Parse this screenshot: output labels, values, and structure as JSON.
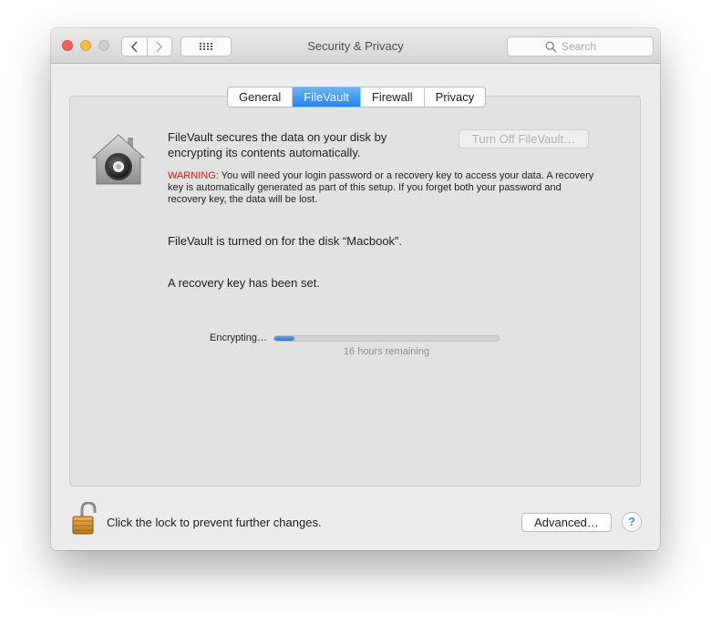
{
  "window": {
    "title": "Security & Privacy"
  },
  "toolbar": {
    "back_icon": "chevron-left-icon",
    "forward_icon": "chevron-right-icon",
    "show_all_icon": "grid-icon",
    "search": {
      "placeholder": "Search",
      "icon": "search-icon"
    }
  },
  "tabs": [
    {
      "label": "General",
      "active": false
    },
    {
      "label": "FileVault",
      "active": true
    },
    {
      "label": "Firewall",
      "active": false
    },
    {
      "label": "Privacy",
      "active": false
    }
  ],
  "filevault": {
    "icon": "filevault-house-safe-icon",
    "intro": "FileVault secures the data on your disk by encrypting its contents automatically.",
    "turn_off_label": "Turn Off FileVault…",
    "warning_label": "WARNING:",
    "warning_text": " You will need your login password or a recovery key to access your data. A recovery key is automatically generated as part of this setup. If you forget both your password and recovery key, the data will be lost.",
    "status_on": "FileVault is turned on for the disk “Macbook”.",
    "status_key": "A recovery key has been set.",
    "encrypting_label": "Encrypting…",
    "progress_percent": 9,
    "remaining": "16 hours remaining"
  },
  "footer": {
    "lock_icon": "unlocked-padlock-icon",
    "lock_text": "Click the lock to prevent further changes.",
    "advanced_label": "Advanced…",
    "help_label": "?"
  },
  "colors": {
    "accent": "#1d85f8",
    "warning": "#e0150e",
    "close": "#fc605c",
    "minimize": "#fdbc40",
    "zoom_disabled": "#cdcdcd"
  }
}
